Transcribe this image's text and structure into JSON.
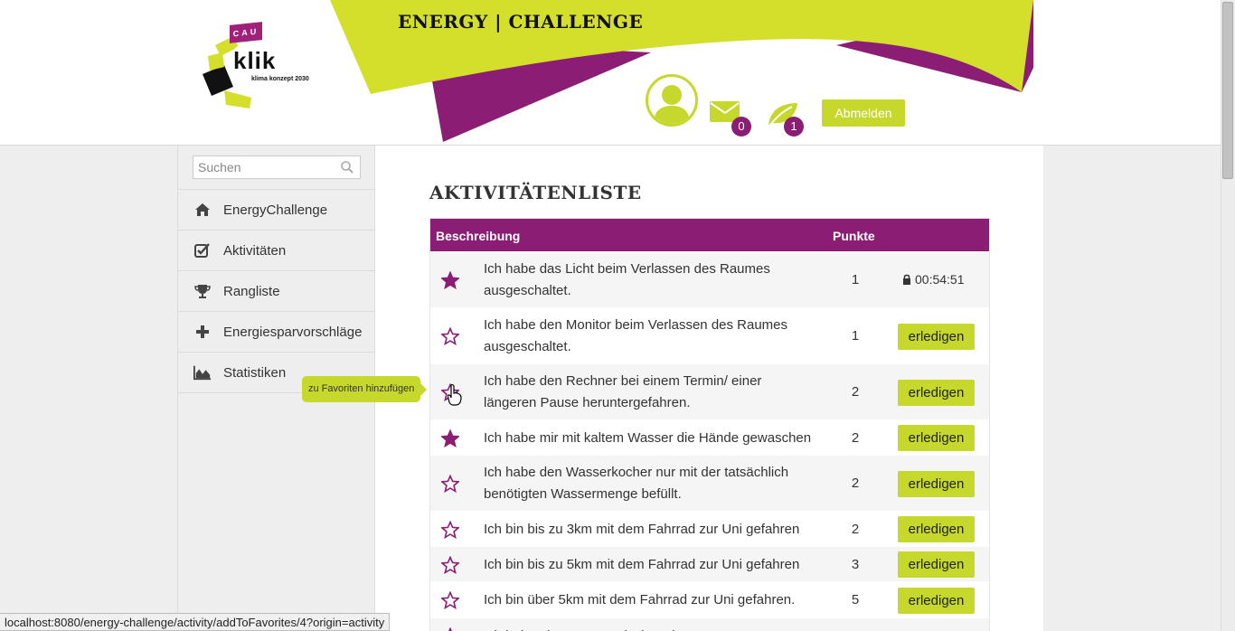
{
  "app": {
    "title": "ENERGY | CHALLENGE",
    "logo": {
      "top_text": "CAU",
      "name": "klik",
      "subtitle": "klima konzept 2030"
    },
    "colors": {
      "accent": "#c6d82c",
      "brand": "#8c1d75"
    }
  },
  "header": {
    "messages_count": "0",
    "activity_count": "1",
    "logout_label": "Abmelden",
    "icons": [
      "user-avatar-icon",
      "envelope-icon",
      "leaf-icon"
    ]
  },
  "sidebar": {
    "search_placeholder": "Suchen",
    "items": [
      {
        "label": "EnergyChallenge",
        "icon": "home-icon"
      },
      {
        "label": "Aktivitäten",
        "icon": "checkbox-icon"
      },
      {
        "label": "Rangliste",
        "icon": "trophy-icon"
      },
      {
        "label": "Energiesparvorschläge",
        "icon": "plus-icon"
      },
      {
        "label": "Statistiken",
        "icon": "area-chart-icon"
      }
    ]
  },
  "main": {
    "title": "AKTIVITÄTENLISTE",
    "columns": {
      "description": "Beschreibung",
      "points": "Punkte"
    },
    "action_label": "erledigen",
    "rows": [
      {
        "line1": "Ich habe das Licht beim Verlassen des Raumes",
        "line2": "ausgeschaltet.",
        "points": "1",
        "favorite": true,
        "timer": "00:54:51"
      },
      {
        "line1": "Ich habe den Monitor beim Verlassen des Raumes",
        "line2": "ausgeschaltet.",
        "points": "1",
        "favorite": false
      },
      {
        "line1": "Ich habe den Rechner bei einem Termin/ einer",
        "line2": "längeren Pause heruntergefahren.",
        "points": "2",
        "favorite": false
      },
      {
        "line1": "Ich habe mir mit kaltem Wasser die Hände gewaschen",
        "line2": "",
        "points": "2",
        "favorite": true
      },
      {
        "line1": "Ich habe den Wasserkocher nur mit der tatsächlich",
        "line2": "benötigten Wassermenge befüllt.",
        "points": "2",
        "favorite": false
      },
      {
        "line1": "Ich bin bis zu 3km mit dem Fahrrad zur Uni gefahren",
        "line2": "",
        "points": "2",
        "favorite": false
      },
      {
        "line1": "Ich bin bis zu 5km mit dem Fahrrad zur Uni gefahren",
        "line2": "",
        "points": "3",
        "favorite": false
      },
      {
        "line1": "Ich bin über 5km mit dem Fahrrad zur Uni gefahren.",
        "line2": "",
        "points": "5",
        "favorite": false
      },
      {
        "line1": "Ich habe einen Weg zwischen den",
        "line2": "",
        "points": "",
        "favorite": false
      }
    ]
  },
  "tooltip": {
    "text": "zu Favoriten hinzufügen"
  },
  "statusbar": {
    "url": "localhost:8080/energy-challenge/activity/addToFavorites/4?origin=activity"
  }
}
